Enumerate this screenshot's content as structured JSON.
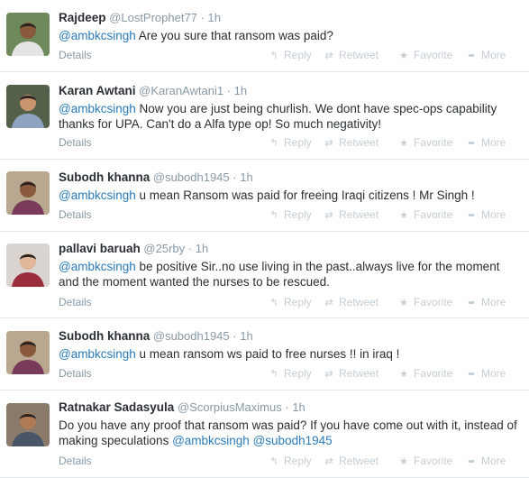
{
  "tweets": [
    {
      "name": "Rajdeep",
      "handle": "@LostProphet77",
      "time": "1h",
      "segments": [
        {
          "text": "@ambkcsingh",
          "mention": true
        },
        {
          "text": " Are you sure that ransom was paid?",
          "mention": false
        }
      ],
      "avatar": {
        "bg": "#6f8a5a",
        "skin": "#8a5a3c",
        "shirt": "#e4e4e4"
      }
    },
    {
      "name": "Karan Awtani",
      "handle": "@KaranAwtani1",
      "time": "1h",
      "segments": [
        {
          "text": "@ambkcsingh",
          "mention": true
        },
        {
          "text": " Now you are just being churlish. We dont have spec-ops capability thanks for UPA. Can't do a Alfa type op! So much negativity!",
          "mention": false
        }
      ],
      "avatar": {
        "bg": "#54604a",
        "skin": "#c8956e",
        "shirt": "#8ea3c0"
      }
    },
    {
      "name": "Subodh khanna",
      "handle": "@subodh1945",
      "time": "1h",
      "segments": [
        {
          "text": "@ambkcsingh",
          "mention": true
        },
        {
          "text": " u mean Ransom was paid for freeing Iraqi citizens ! Mr Singh !",
          "mention": false
        }
      ],
      "avatar": {
        "bg": "#b9a88f",
        "skin": "#8a5a3c",
        "shirt": "#7a3a5a"
      }
    },
    {
      "name": "pallavi baruah",
      "handle": "@25rby",
      "time": "1h",
      "segments": [
        {
          "text": "@ambkcsingh",
          "mention": true
        },
        {
          "text": " be positive Sir..no use living in the past..always live for the moment and the moment wanted the nurses to be rescued.",
          "mention": false
        }
      ],
      "avatar": {
        "bg": "#d9d4cf",
        "skin": "#e0b799",
        "shirt": "#9a2e3c"
      }
    },
    {
      "name": "Subodh khanna",
      "handle": "@subodh1945",
      "time": "1h",
      "segments": [
        {
          "text": "@ambkcsingh",
          "mention": true
        },
        {
          "text": " u mean ransom ws paid to free nurses !! in iraq !",
          "mention": false
        }
      ],
      "avatar": {
        "bg": "#b9a88f",
        "skin": "#8a5a3c",
        "shirt": "#7a3a5a"
      }
    },
    {
      "name": "Ratnakar Sadasyula",
      "handle": "@ScorpiusMaximus",
      "time": "1h",
      "segments": [
        {
          "text": "Do you have any proof that ransom was paid? If you have come out with it, instead of making speculations ",
          "mention": false
        },
        {
          "text": "@ambkcsingh",
          "mention": true
        },
        {
          "text": " ",
          "mention": false
        },
        {
          "text": "@subodh1945",
          "mention": true
        }
      ],
      "avatar": {
        "bg": "#8a7a6a",
        "skin": "#b07a55",
        "shirt": "#4a5668"
      }
    }
  ],
  "actions": {
    "details": "Details",
    "reply": "Reply",
    "retweet": "Retweet",
    "favorite": "Favorite",
    "more": "More"
  },
  "dot": "·"
}
